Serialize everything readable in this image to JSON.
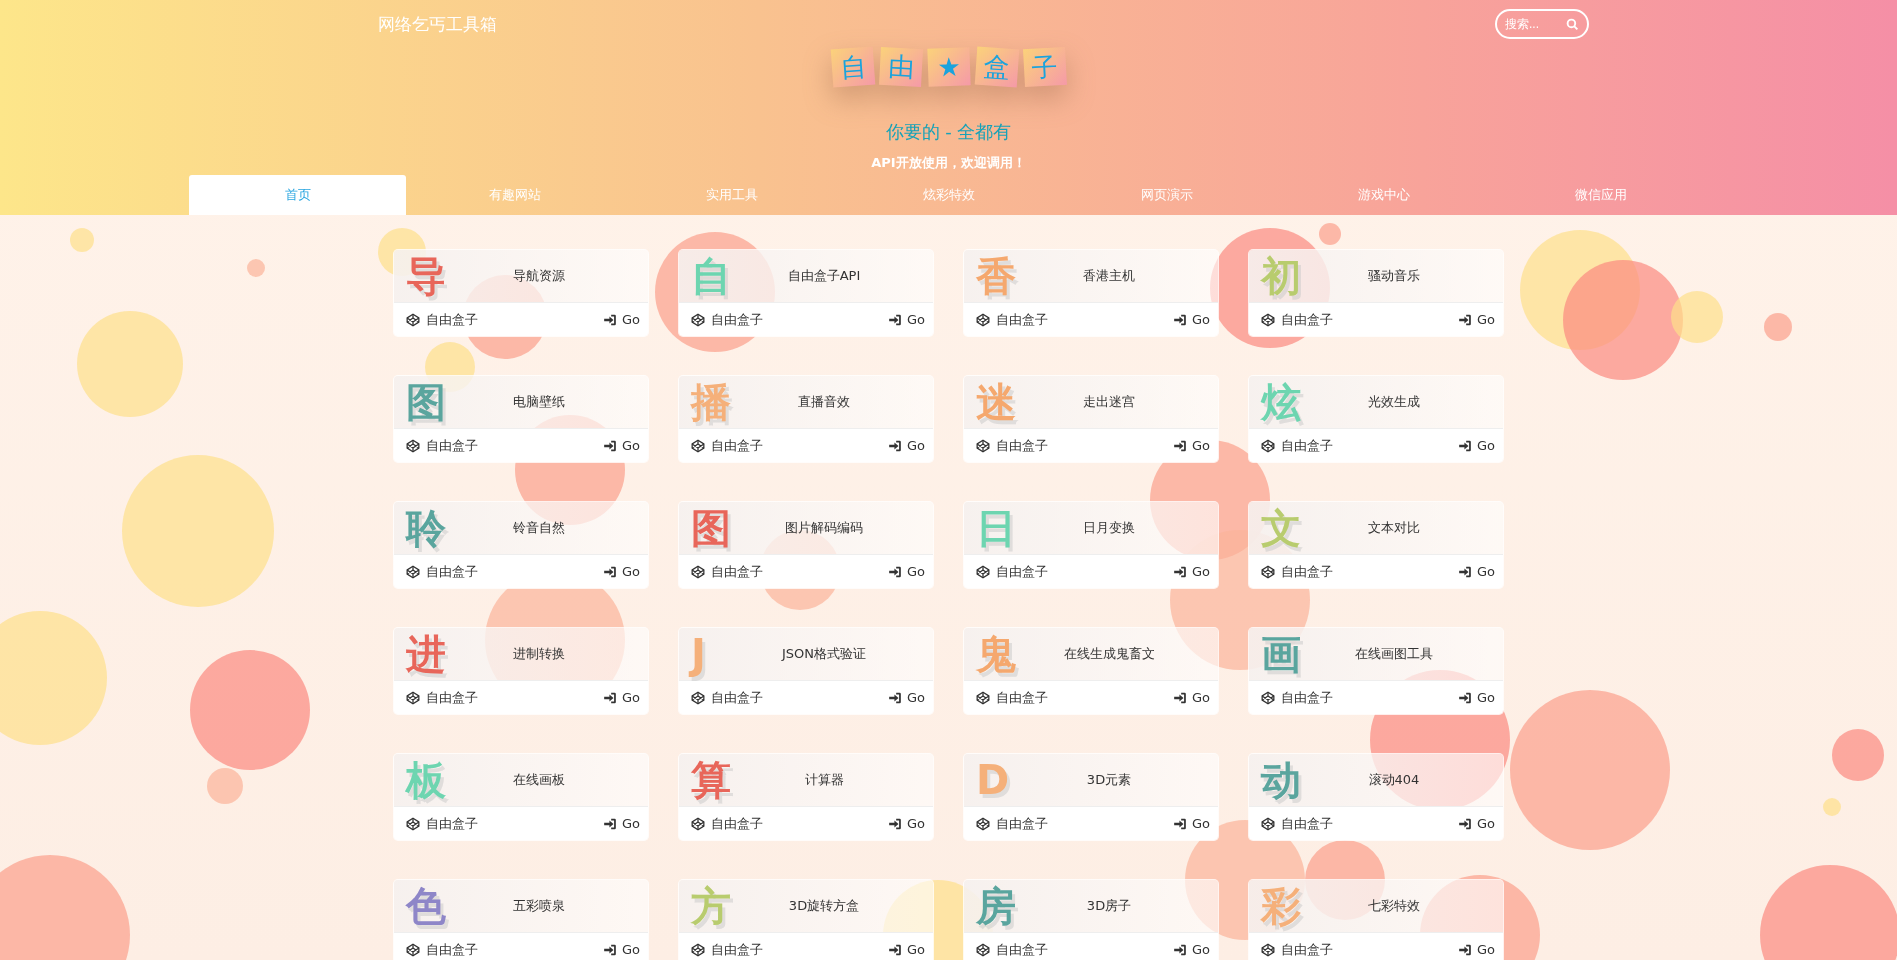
{
  "header": {
    "site_title": "网络乞丐工具箱",
    "search": {
      "placeholder": "搜索..."
    },
    "logo_tiles": [
      "自",
      "由",
      "★",
      "盒",
      "子"
    ],
    "slogan": "你要的 - 全都有",
    "subtitle": "API开放使用，欢迎调用！"
  },
  "tabs": [
    {
      "label": "首页",
      "selected": true
    },
    {
      "label": "有趣网站",
      "selected": false
    },
    {
      "label": "实用工具",
      "selected": false
    },
    {
      "label": "炫彩特效",
      "selected": false
    },
    {
      "label": "网页演示",
      "selected": false
    },
    {
      "label": "游戏中心",
      "selected": false
    },
    {
      "label": "微信应用",
      "selected": false
    }
  ],
  "cards": [
    {
      "glyph": "导",
      "color": "#e8665a",
      "title": "导航资源",
      "source": "自由盒子",
      "action": "Go"
    },
    {
      "glyph": "自",
      "color": "#6dd5b0",
      "title": "自由盒子API",
      "source": "自由盒子",
      "action": "Go"
    },
    {
      "glyph": "香",
      "color": "#f5a86e",
      "title": "香港主机",
      "source": "自由盒子",
      "action": "Go"
    },
    {
      "glyph": "初",
      "color": "#b8cc6e",
      "title": "骚动音乐",
      "source": "自由盒子",
      "action": "Go"
    },
    {
      "glyph": "图",
      "color": "#5aa59e",
      "title": "电脑壁纸",
      "source": "自由盒子",
      "action": "Go"
    },
    {
      "glyph": "播",
      "color": "#f5b07a",
      "title": "直播音效",
      "source": "自由盒子",
      "action": "Go"
    },
    {
      "glyph": "迷",
      "color": "#f5a86e",
      "title": "走出迷宫",
      "source": "自由盒子",
      "action": "Go"
    },
    {
      "glyph": "炫",
      "color": "#6dd5b0",
      "title": "光效生成",
      "source": "自由盒子",
      "action": "Go"
    },
    {
      "glyph": "聆",
      "color": "#5aa59e",
      "title": "铃音自然",
      "source": "自由盒子",
      "action": "Go"
    },
    {
      "glyph": "图",
      "color": "#e8665a",
      "title": "图片解码编码",
      "source": "自由盒子",
      "action": "Go"
    },
    {
      "glyph": "日",
      "color": "#6dd5b0",
      "title": "日月变换",
      "source": "自由盒子",
      "action": "Go"
    },
    {
      "glyph": "文",
      "color": "#b8cc6e",
      "title": "文本对比",
      "source": "自由盒子",
      "action": "Go"
    },
    {
      "glyph": "进",
      "color": "#e8665a",
      "title": "进制转换",
      "source": "自由盒子",
      "action": "Go"
    },
    {
      "glyph": "J",
      "color": "#f5b07a",
      "title": "JSON格式验证",
      "source": "自由盒子",
      "action": "Go"
    },
    {
      "glyph": "鬼",
      "color": "#f5a86e",
      "title": "在线生成鬼畜文",
      "source": "自由盒子",
      "action": "Go"
    },
    {
      "glyph": "画",
      "color": "#5aa59e",
      "title": "在线画图工具",
      "source": "自由盒子",
      "action": "Go"
    },
    {
      "glyph": "板",
      "color": "#6dd5b0",
      "title": "在线画板",
      "source": "自由盒子",
      "action": "Go"
    },
    {
      "glyph": "算",
      "color": "#e8665a",
      "title": "计算器",
      "source": "自由盒子",
      "action": "Go"
    },
    {
      "glyph": "D",
      "color": "#f5b07a",
      "title": "3D元素",
      "source": "自由盒子",
      "action": "Go"
    },
    {
      "glyph": "动",
      "color": "#5aa59e",
      "title": "滚动404",
      "source": "自由盒子",
      "action": "Go"
    },
    {
      "glyph": "色",
      "color": "#8e86c8",
      "title": "五彩喷泉",
      "source": "自由盒子",
      "action": "Go"
    },
    {
      "glyph": "方",
      "color": "#b8cc6e",
      "title": "3D旋转方盒",
      "source": "自由盒子",
      "action": "Go"
    },
    {
      "glyph": "房",
      "color": "#5aa59e",
      "title": "3D房子",
      "source": "自由盒子",
      "action": "Go"
    },
    {
      "glyph": "彩",
      "color": "#f5b07a",
      "title": "七彩特效",
      "source": "自由盒子",
      "action": "Go"
    }
  ]
}
